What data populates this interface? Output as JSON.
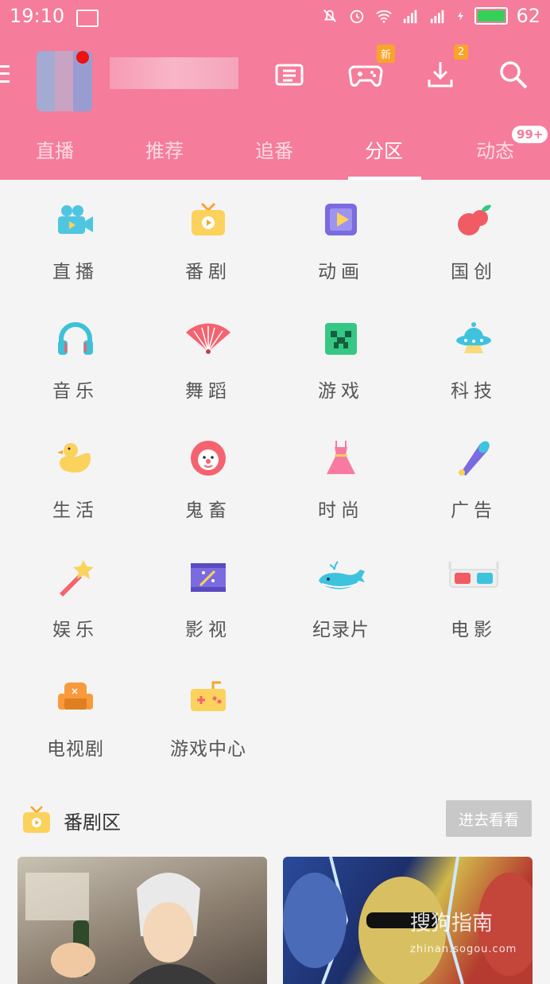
{
  "statusbar": {
    "time": "19:10",
    "battery": "62"
  },
  "topbar": {
    "game_badge": "新",
    "download_badge": "2"
  },
  "tabs": [
    {
      "label": "直播"
    },
    {
      "label": "推荐"
    },
    {
      "label": "追番"
    },
    {
      "label": "分区"
    },
    {
      "label": "动态"
    }
  ],
  "tab_dynamic_badge": "99+",
  "categories": [
    {
      "label": "直播",
      "icon": "camera-icon",
      "color": "#4fc6e0"
    },
    {
      "label": "番剧",
      "icon": "tv-icon",
      "color": "#fbd25c"
    },
    {
      "label": "动画",
      "icon": "play-icon",
      "color": "#7b6be0"
    },
    {
      "label": "国创",
      "icon": "peach-icon",
      "color": "#f05b64"
    },
    {
      "label": "音乐",
      "icon": "headphones-icon",
      "color": "#3cc2d6"
    },
    {
      "label": "舞蹈",
      "icon": "fan-icon",
      "color": "#f4636f"
    },
    {
      "label": "游戏",
      "icon": "creeper-icon",
      "color": "#36c785"
    },
    {
      "label": "科技",
      "icon": "ufo-icon",
      "color": "#3ec3de"
    },
    {
      "label": "生活",
      "icon": "duck-icon",
      "color": "#fbd25c"
    },
    {
      "label": "鬼畜",
      "icon": "clown-icon",
      "color": "#f4636f"
    },
    {
      "label": "时尚",
      "icon": "dress-icon",
      "color": "#f97aa0"
    },
    {
      "label": "广告",
      "icon": "megaphone-icon",
      "color": "#7b6be0"
    },
    {
      "label": "娱乐",
      "icon": "magic-wand-icon",
      "color": "#fbd25c"
    },
    {
      "label": "影视",
      "icon": "film-icon",
      "color": "#7b6be0"
    },
    {
      "label": "纪录片",
      "icon": "whale-icon",
      "color": "#3ec3de"
    },
    {
      "label": "电影",
      "icon": "3d-glasses-icon",
      "color": "#f05b64"
    },
    {
      "label": "电视剧",
      "icon": "sofa-icon",
      "color": "#f89a3c"
    },
    {
      "label": "游戏中心",
      "icon": "gamepad-icon",
      "color": "#fbd25c"
    }
  ],
  "section": {
    "title": "番剧区",
    "button": "进去看看"
  },
  "watermark": {
    "brand": "搜狗指南",
    "url": "zhinan.sogou.com"
  }
}
